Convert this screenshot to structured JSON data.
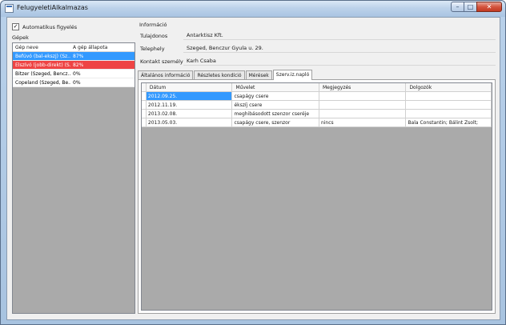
{
  "window": {
    "title": "FelugyeletiAlkalmazas",
    "minimize": "–",
    "maximize": "□",
    "close": "✕"
  },
  "monitoring": {
    "auto_label": "Automatikus figyelés",
    "checked": true,
    "check_glyph": "✓"
  },
  "machines": {
    "group_title": "Gépek",
    "columns": [
      "Gép neve",
      "A gép állapota"
    ],
    "rows": [
      {
        "name": "Befúvó (bal-ekszj) (Sz...",
        "status": "87%",
        "state": "selected"
      },
      {
        "name": "Elszívó (jobb-direkt) (S...",
        "status": "82%",
        "state": "alert"
      },
      {
        "name": "Bitzer (Szeged, Bencz...",
        "status": "0%",
        "state": "normal"
      },
      {
        "name": "Copeland (Szeged, Be...",
        "status": "0%",
        "state": "normal"
      }
    ]
  },
  "info": {
    "group_title": "Információ",
    "fields": [
      {
        "label": "Tulajdonos",
        "value": "Antarktisz Kft."
      },
      {
        "label": "Telephely",
        "value": "Szeged, Benczur Gyula u. 29."
      },
      {
        "label": "Kontakt személy",
        "value": "Karh Csaba"
      }
    ]
  },
  "tabs": [
    {
      "label": "Általános információ",
      "active": false
    },
    {
      "label": "Részletes kondíció",
      "active": false
    },
    {
      "label": "Mérések",
      "active": false
    },
    {
      "label": "Szerv.iz.napló",
      "active": true
    }
  ],
  "log": {
    "columns": [
      "Dátum",
      "Művelet",
      "Megjegyzés",
      "Dolgozók"
    ],
    "rows": [
      {
        "date": "2012.09.25.",
        "action": "csapágy csere",
        "note": "",
        "workers": "",
        "selected": true
      },
      {
        "date": "2012.11.19.",
        "action": "ékszíj csere",
        "note": "",
        "workers": "",
        "selected": false
      },
      {
        "date": "2013.02.08.",
        "action": "meghibásodott szenzor cseréje",
        "note": "",
        "workers": "",
        "selected": false
      },
      {
        "date": "2013.05.03.",
        "action": "csapágy csere, szenzor",
        "note": "nincs",
        "workers": "Bala Constantin; Bálint Zsolt;",
        "selected": false
      }
    ]
  },
  "colors": {
    "selected_row": "#3399ff",
    "alert_row": "#ee4444",
    "empty_grid": "#aaaaaa"
  }
}
